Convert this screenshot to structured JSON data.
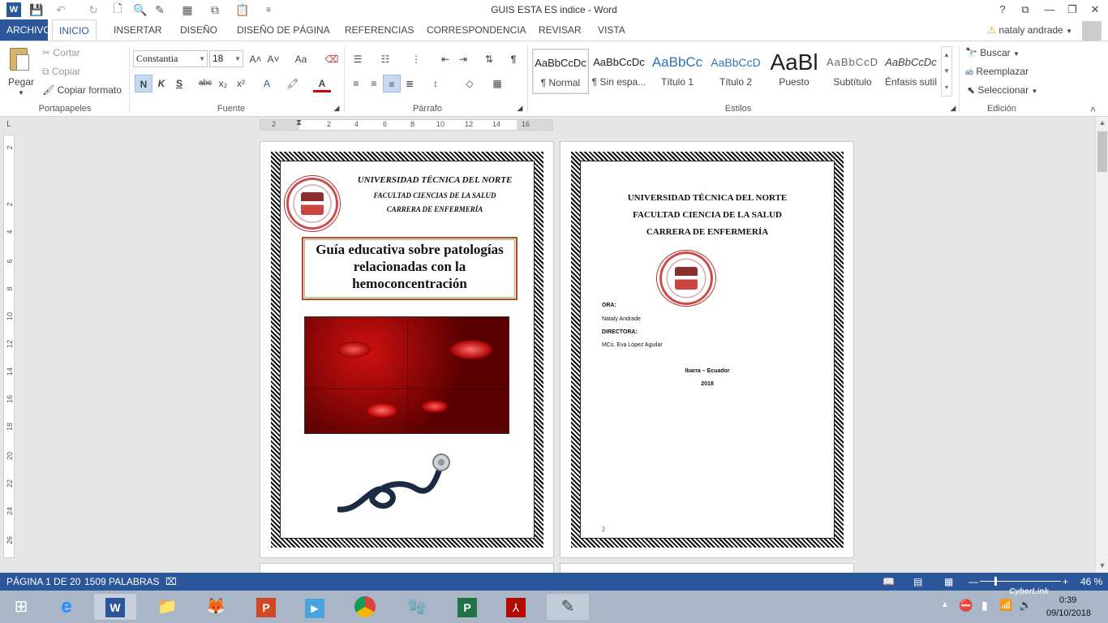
{
  "window": {
    "title": "GUIS ESTA ES indice - Word",
    "help": "?",
    "restore": "⧉",
    "minimize": "—",
    "maximize": "❐",
    "close": "✕"
  },
  "tabs": {
    "file": "ARCHIVO",
    "items": [
      "INICIO",
      "INSERTAR",
      "DISEÑO",
      "DISEÑO DE PÁGINA",
      "REFERENCIAS",
      "CORRESPONDENCIA",
      "REVISAR",
      "VISTA"
    ],
    "user": "nataly andrade",
    "warning_icon": "⚠"
  },
  "clipboard": {
    "paste": "Pegar",
    "cut": "Cortar",
    "copy": "Copiar",
    "format_painter": "Copiar formato",
    "label": "Portapapeles"
  },
  "font": {
    "name": "Constantia",
    "size": "18",
    "bold": "N",
    "italic": "K",
    "underline": "S",
    "strike": "abc",
    "sub": "x₂",
    "sup": "x²",
    "grow": "A˄",
    "shrink": "A˅",
    "case": "Aa",
    "label": "Fuente"
  },
  "paragraph": {
    "pilcrow": "¶",
    "label": "Párrafo"
  },
  "styles": {
    "items": [
      {
        "preview": "AaBbCcDc",
        "name": "¶ Normal"
      },
      {
        "preview": "AaBbCcDc",
        "name": "¶ Sin espa..."
      },
      {
        "preview": "AaBbCc",
        "name": "Título 1"
      },
      {
        "preview": "AaBbCcD",
        "name": "Título 2"
      },
      {
        "preview": "AaBl",
        "name": "Puesto"
      },
      {
        "preview": "AaBbCcD",
        "name": "Subtítulo"
      },
      {
        "preview": "AaBbCcDc",
        "name": "Énfasis sutil"
      }
    ],
    "label": "Estilos"
  },
  "editing": {
    "find": "Buscar",
    "replace": "Reemplazar",
    "select": "Seleccionar",
    "label": "Edición"
  },
  "ruler": {
    "h": [
      "2",
      "2",
      "4",
      "6",
      "8",
      "10",
      "12",
      "14",
      "16"
    ],
    "v": [
      "2",
      "2",
      "4",
      "6",
      "8",
      "10",
      "12",
      "14",
      "16",
      "18",
      "20",
      "22",
      "24",
      "26"
    ],
    "tab_marker": "L"
  },
  "page1": {
    "uni": "UNIVERSIDAD TÉCNICA DEL NORTE",
    "faculty": "FACULTAD CIENCIAS DE LA SALUD",
    "career": "CARRERA DE ENFERMERÍA",
    "title": "Guía educativa sobre patologías relacionadas con la hemoconcentración"
  },
  "page2": {
    "uni": "UNIVERSIDAD TÉCNICA DEL NORTE",
    "faculty": "FACULTAD CIENCIA DE LA SALUD",
    "career": "CARRERA DE ENFERMERÍA",
    "author_label": "ORA:",
    "author": "Nataly Andrade",
    "director_label": "DIRECTORA:",
    "director": "MCs. Eva López Aguilar",
    "place": "Ibarra – Ecuador",
    "year": "2018",
    "page_number": "2"
  },
  "status": {
    "page": "PÁGINA 1 DE 20",
    "words": "1509 PALABRAS",
    "zoom": "46 %"
  },
  "taskbar": {
    "time": "0:39",
    "date": "09/10/2018",
    "cyberlink": "CyberLink"
  },
  "colors": {
    "accent": "#2b579a",
    "taskbar": "#a8b6c8"
  }
}
